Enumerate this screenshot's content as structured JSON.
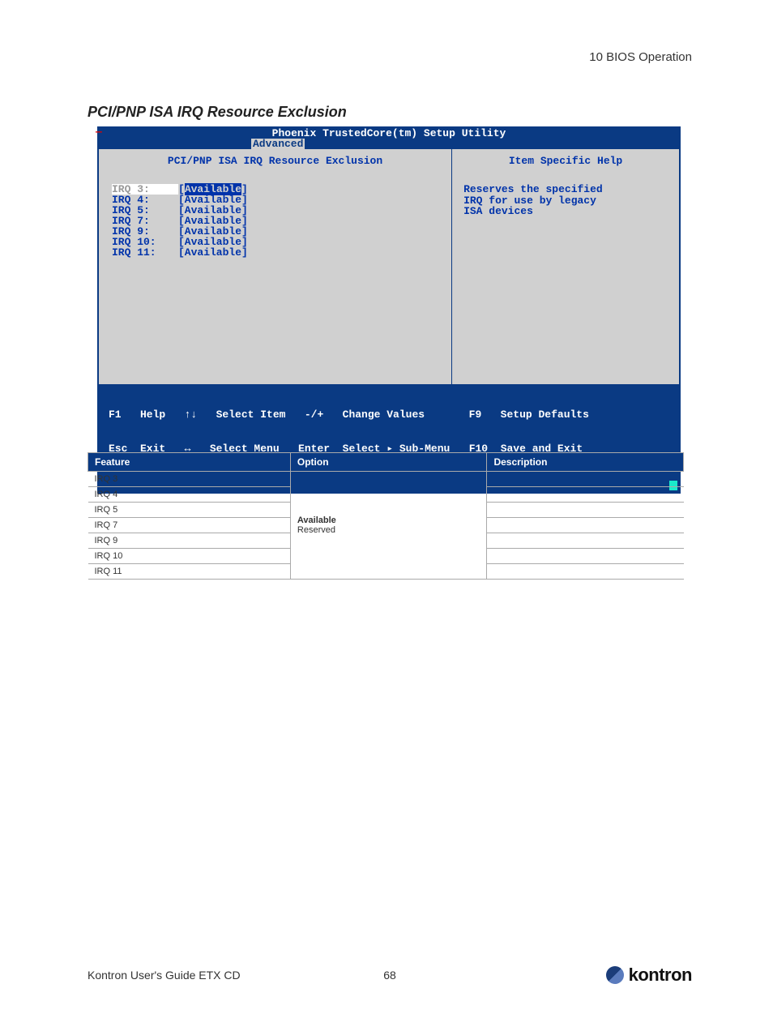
{
  "page": {
    "header_right": "10 BIOS Operation",
    "section_title": "PCI/PNP ISA IRQ Resource Exclusion",
    "footer_guide": "Kontron User's Guide ETX CD",
    "footer_page": "68",
    "logo_text": "kontron"
  },
  "bios": {
    "title": "Phoenix TrustedCore(tm) Setup Utility",
    "active_tab": "Advanced",
    "panel_title": "PCI/PNP ISA IRQ Resource Exclusion",
    "help_title": "Item Specific Help",
    "help_body": "Reserves the specified\nIRQ for use by legacy\nISA devices",
    "items": [
      {
        "label": "IRQ 3:",
        "value": "[Available]",
        "selected": true
      },
      {
        "label": "IRQ 4:",
        "value": "[Available]",
        "selected": false
      },
      {
        "label": "IRQ 5:",
        "value": "[Available]",
        "selected": false
      },
      {
        "label": "IRQ 7:",
        "value": "[Available]",
        "selected": false
      },
      {
        "label": "IRQ 9:",
        "value": "[Available]",
        "selected": false
      },
      {
        "label": "IRQ 10:",
        "value": "[Available]",
        "selected": false
      },
      {
        "label": "IRQ 11:",
        "value": "[Available]",
        "selected": false
      }
    ],
    "footer": {
      "line1": "F1   Help   ↑↓   Select Item   -/+   Change Values       F9   Setup Defaults",
      "line2": "Esc  Exit   ↔   Select Menu   Enter  Select ▸ Sub-Menu   F10  Save and Exit"
    }
  },
  "table": {
    "headers": {
      "feature": "Feature",
      "option": "Option",
      "description": "Description"
    },
    "features": [
      "IRQ 3",
      "IRQ 4",
      "IRQ 5",
      "IRQ 7",
      "IRQ 9",
      "IRQ 10",
      "IRQ 11"
    ],
    "option_bold": "Available",
    "option_normal": "Reserved"
  }
}
